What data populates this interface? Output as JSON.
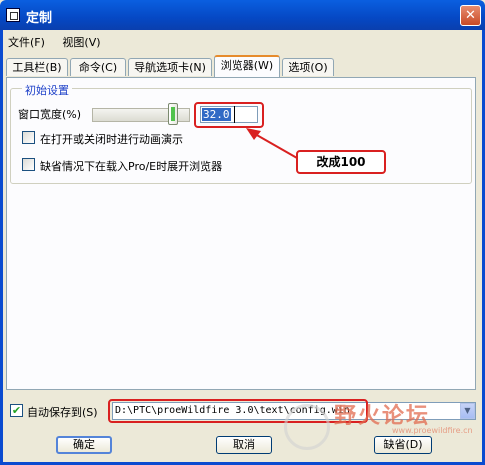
{
  "window": {
    "title": "定制",
    "close_glyph": "✕"
  },
  "menu": [
    {
      "label": "文件(F)"
    },
    {
      "label": "视图(V)"
    }
  ],
  "tabs": [
    {
      "label": "工具栏(B)"
    },
    {
      "label": "命令(C)"
    },
    {
      "label": "导航选项卡(N)"
    },
    {
      "label": "浏览器(W)"
    },
    {
      "label": "选项(O)"
    }
  ],
  "browser_tab": {
    "group_title": "初始设置",
    "window_width_label": "窗口宽度(%)",
    "window_width_value": "32.0",
    "slider_fraction": 0.32,
    "checkbox_animate_label": "在打开或关闭时进行动画演示",
    "checkbox_animate_checked": false,
    "checkbox_expand_label": "缺省情况下在载入Pro/E时展开浏览器",
    "checkbox_expand_checked": false
  },
  "annotation": {
    "text": "改成100",
    "color": "#d92020"
  },
  "autosave": {
    "label": "自动保存到(S)",
    "checked": true,
    "check_glyph": "✔",
    "path": "D:\\PTC\\proeWildfire 3.0\\text\\config.win",
    "dropdown_glyph": "▼"
  },
  "buttons": {
    "ok": "确定",
    "cancel": "取消",
    "default": "缺省(D)"
  },
  "watermark": {
    "text": "野火论坛",
    "url": "www.proewildfire.cn"
  },
  "colors": {
    "title_bar": "#0548c4",
    "accent_tab": "#e68b2c",
    "annotation_red": "#d92020"
  }
}
